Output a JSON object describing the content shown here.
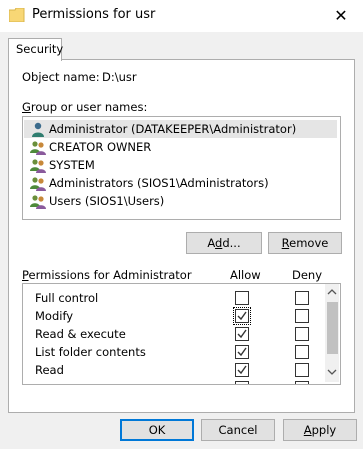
{
  "window": {
    "title": "Permissions for usr",
    "close_glyph": "✕"
  },
  "tabs": [
    {
      "label": "Security"
    }
  ],
  "object": {
    "label": "Object name:",
    "value": "D:\\usr"
  },
  "groups": {
    "label_mnemonic": "G",
    "label_rest": "roup or user names:",
    "items": [
      {
        "name": "Administrator (DATAKEEPER\\Administrator)",
        "icon": "single-user-icon",
        "selected": true
      },
      {
        "name": "CREATOR OWNER",
        "icon": "user-group-icon"
      },
      {
        "name": "SYSTEM",
        "icon": "user-group-icon"
      },
      {
        "name": "Administrators (SIOS1\\Administrators)",
        "icon": "user-group-icon"
      },
      {
        "name": "Users (SIOS1\\Users)",
        "icon": "user-group-icon"
      }
    ]
  },
  "buttons": {
    "add_pre": "A",
    "add_mn": "d",
    "add_post": "d...",
    "remove_mn": "R",
    "remove_post": "emove",
    "ok": "OK",
    "cancel": "Cancel",
    "apply_mn": "A",
    "apply_post": "pply"
  },
  "permissions": {
    "label_mnemonic": "P",
    "label_rest": "ermissions for Administrator",
    "allow_header": "Allow",
    "deny_header": "Deny",
    "rows": [
      {
        "name": "Full control",
        "allow": false,
        "deny": false
      },
      {
        "name": "Modify",
        "allow": true,
        "deny": false
      },
      {
        "name": "Read & execute",
        "allow": true,
        "deny": false
      },
      {
        "name": "List folder contents",
        "allow": true,
        "deny": false
      },
      {
        "name": "Read",
        "allow": true,
        "deny": false
      }
    ]
  },
  "colors": {
    "accent": "#0078d7",
    "folder": "#f8d775",
    "check": "#333333"
  }
}
